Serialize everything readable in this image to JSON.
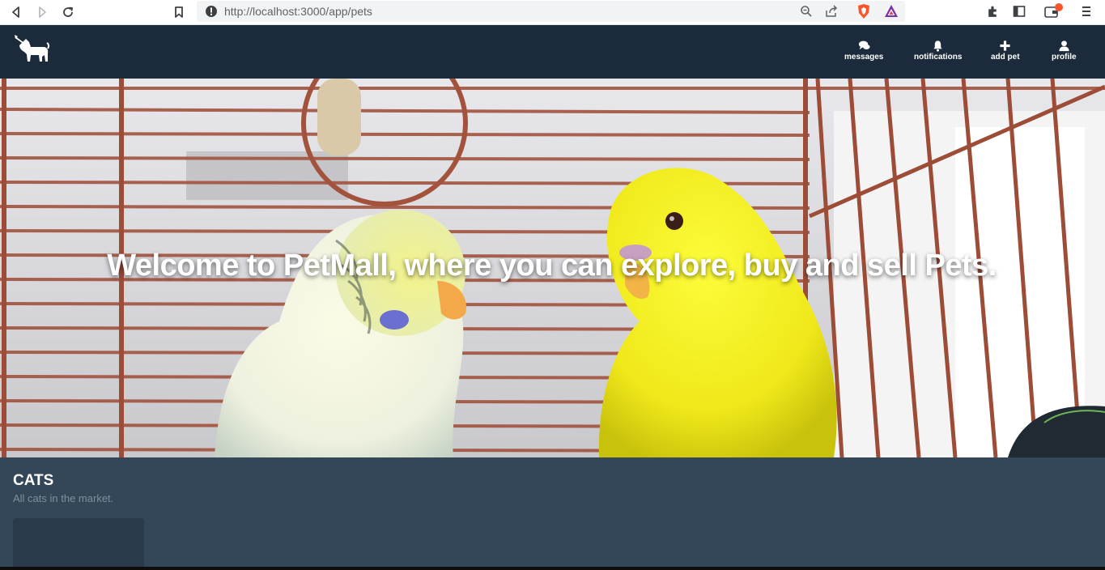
{
  "browser": {
    "url": "http://localhost:3000/app/pets"
  },
  "nav": {
    "items": [
      {
        "label": "messages",
        "icon": "comments-icon"
      },
      {
        "label": "notifications",
        "icon": "bell-icon"
      },
      {
        "label": "add pet",
        "icon": "plus-icon"
      },
      {
        "label": "profile",
        "icon": "user-icon"
      }
    ]
  },
  "hero": {
    "title": "Welcome to PetMall, where you can explore, buy and sell Pets."
  },
  "section": {
    "title": "CATS",
    "subtitle": "All cats in the market."
  },
  "colors": {
    "nav_bg": "#1b2b3c",
    "section_bg": "#344758",
    "card_bg": "#2a3a4b"
  }
}
